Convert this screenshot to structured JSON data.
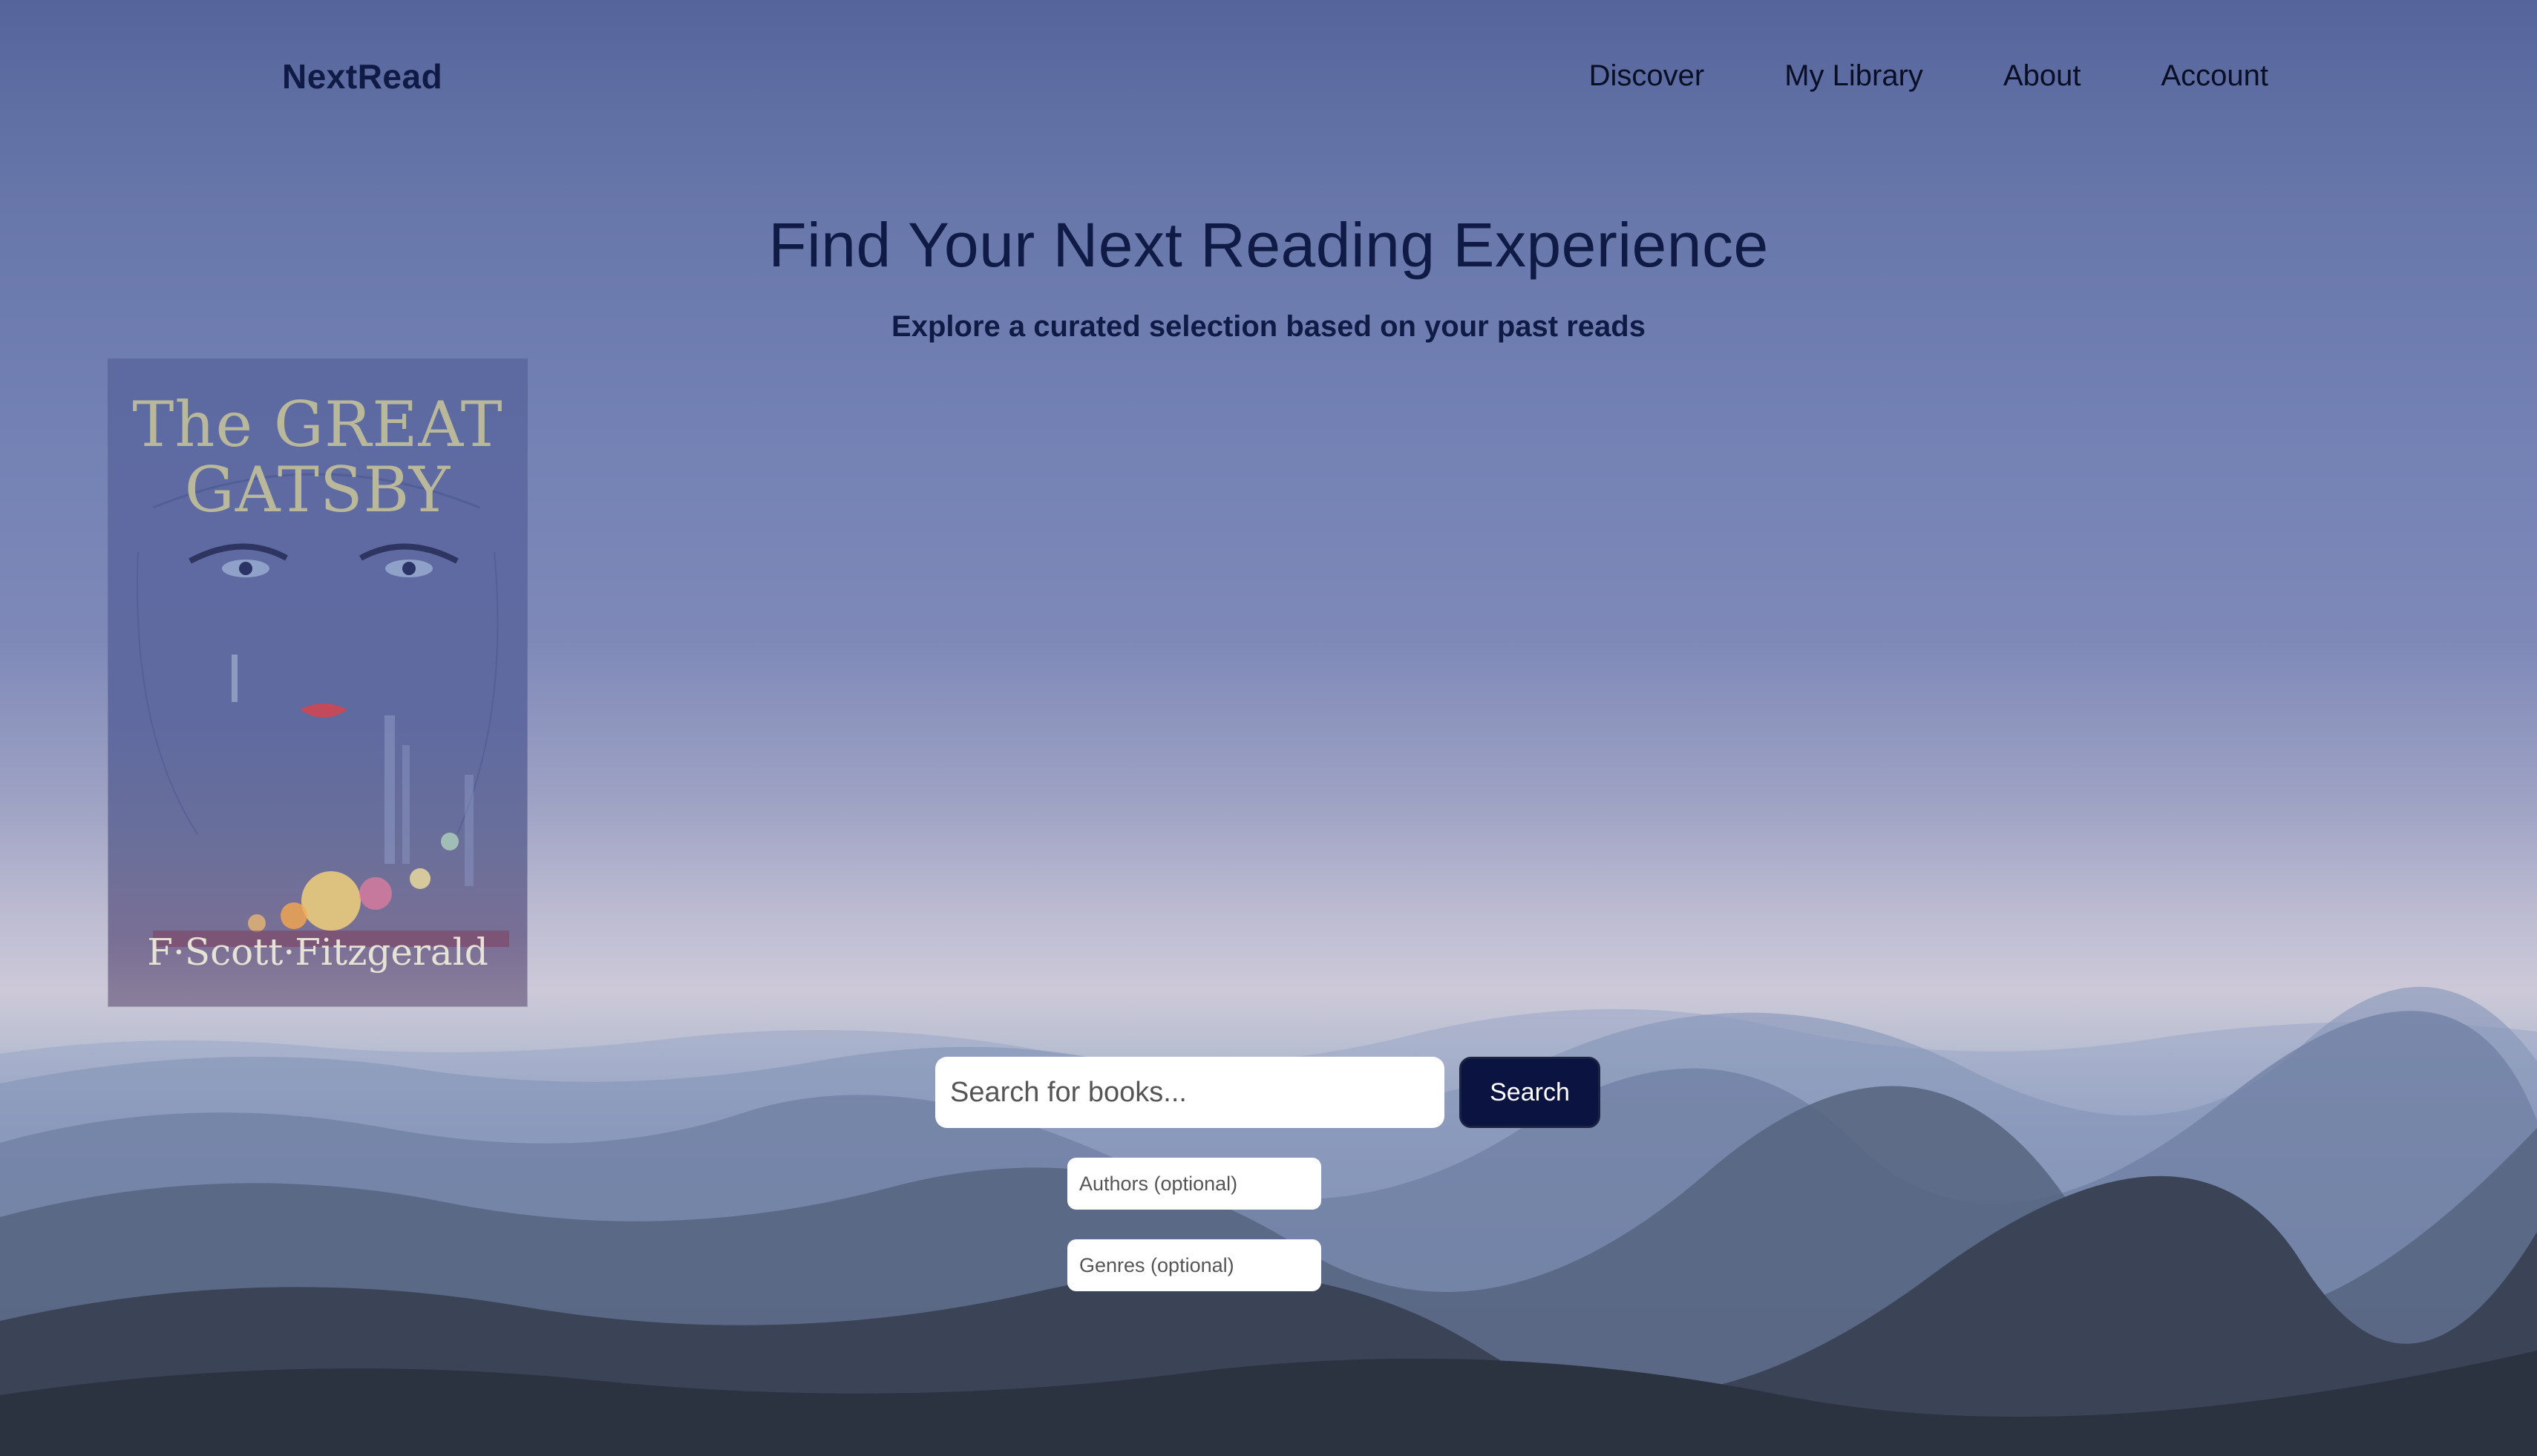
{
  "brand": {
    "name": "NextRead"
  },
  "nav": {
    "items": [
      {
        "label": "Discover"
      },
      {
        "label": "My Library"
      },
      {
        "label": "About"
      },
      {
        "label": "Account"
      }
    ]
  },
  "hero": {
    "title": "Find Your Next Reading Experience",
    "subtitle": "Explore a curated selection based on your past reads"
  },
  "book": {
    "title_line1": "The GREAT",
    "title_line2": "GATSBY",
    "author": "F·Scott·Fitzgerald"
  },
  "search": {
    "placeholder": "Search for books...",
    "button_label": "Search",
    "authors_placeholder": "Authors (optional)",
    "genres_placeholder": "Genres (optional)"
  },
  "colors": {
    "brand": "#0f1a45",
    "button": "#0b1440"
  }
}
